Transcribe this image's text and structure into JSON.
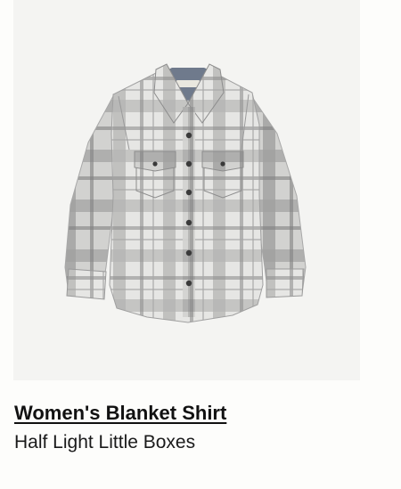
{
  "product": {
    "name": "Women's Blanket Shirt",
    "variant": "Half Light Little Boxes"
  },
  "colors": {
    "image_background": "#f4f4f2",
    "shirt_base": "#dcdcdc",
    "plaid_stripe": "#9e9e9e",
    "text": "#111111"
  },
  "icons": {
    "product_image": "plaid-shirt-image"
  }
}
